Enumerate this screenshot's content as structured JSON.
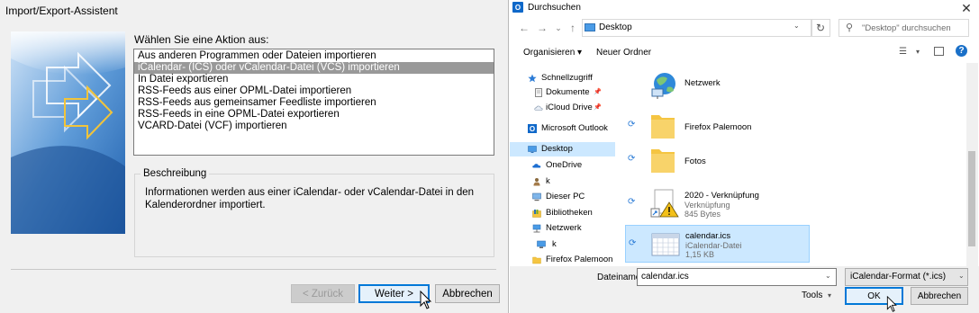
{
  "wizard": {
    "title": "Import/Export-Assistent",
    "prompt": "Wählen Sie eine Aktion aus:",
    "actions": [
      "Aus anderen Programmen oder Dateien importieren",
      "iCalendar- (ICS) oder vCalendar-Datei (VCS) importieren",
      "In Datei exportieren",
      "RSS-Feeds aus einer OPML-Datei importieren",
      "RSS-Feeds aus gemeinsamer Feedliste importieren",
      "RSS-Feeds in eine OPML-Datei exportieren",
      "VCARD-Datei (VCF) importieren"
    ],
    "selected_action_index": 1,
    "description_title": "Beschreibung",
    "description_text": "Informationen werden aus einer iCalendar- oder vCalendar-Datei in den Kalenderordner importiert.",
    "buttons": {
      "back": "< Zurück",
      "next": "Weiter >",
      "cancel": "Abbrechen"
    }
  },
  "dialog": {
    "title": "Durchsuchen",
    "app_icon": "O",
    "address": "Desktop",
    "search_placeholder": "\"Desktop\" durchsuchen",
    "toolbar": {
      "organise": "Organisieren ▾",
      "new_folder": "Neuer Ordner"
    },
    "nav_items": [
      {
        "label": "Schnellzugriff",
        "icon": "star-icon"
      },
      {
        "label": "Dokumente",
        "icon": "document-icon",
        "pinned": true
      },
      {
        "label": "iCloud Drive",
        "icon": "cloud-icon",
        "pinned": true
      },
      {
        "label": "Microsoft Outlook",
        "icon": "outlook-icon"
      },
      {
        "label": "Desktop",
        "icon": "desktop-icon",
        "selected": true
      },
      {
        "label": "OneDrive",
        "icon": "onedrive-icon"
      },
      {
        "label": "k",
        "icon": "user-icon"
      },
      {
        "label": "Dieser PC",
        "icon": "pc-icon"
      },
      {
        "label": "Bibliotheken",
        "icon": "library-icon"
      },
      {
        "label": "Netzwerk",
        "icon": "network-icon"
      },
      {
        "label": "k",
        "icon": "computer-icon"
      },
      {
        "label": "Firefox Palemoon",
        "icon": "folder-icon"
      }
    ],
    "files": [
      {
        "name": "Netzwerk",
        "icon": "network-globe-icon"
      },
      {
        "name": "Firefox Palemoon",
        "icon": "folder-icon",
        "sync": true
      },
      {
        "name": "Fotos",
        "icon": "folder-icon",
        "sync": true
      },
      {
        "name": "2020 - Verknüpfung",
        "sub1": "Verknüpfung",
        "sub2": "845 Bytes",
        "icon": "shortcut-warning-icon",
        "sync": true
      },
      {
        "name": "calendar.ics",
        "sub1": "iCalendar-Datei",
        "sub2": "1,15 KB",
        "icon": "calendar-file-icon",
        "sync": true,
        "selected": true
      }
    ],
    "filename_label": "Dateiname:",
    "filename_value": "calendar.ics",
    "filter_value": "iCalendar-Format (*.ics)",
    "tools_label": "Tools",
    "ok_label": "OK",
    "cancel_label": "Abbrechen"
  },
  "colors": {
    "selection_gray": "#999999",
    "selection_blue": "#cce8ff",
    "accent": "#0078d7",
    "folder_yellow": "#f5c542"
  }
}
